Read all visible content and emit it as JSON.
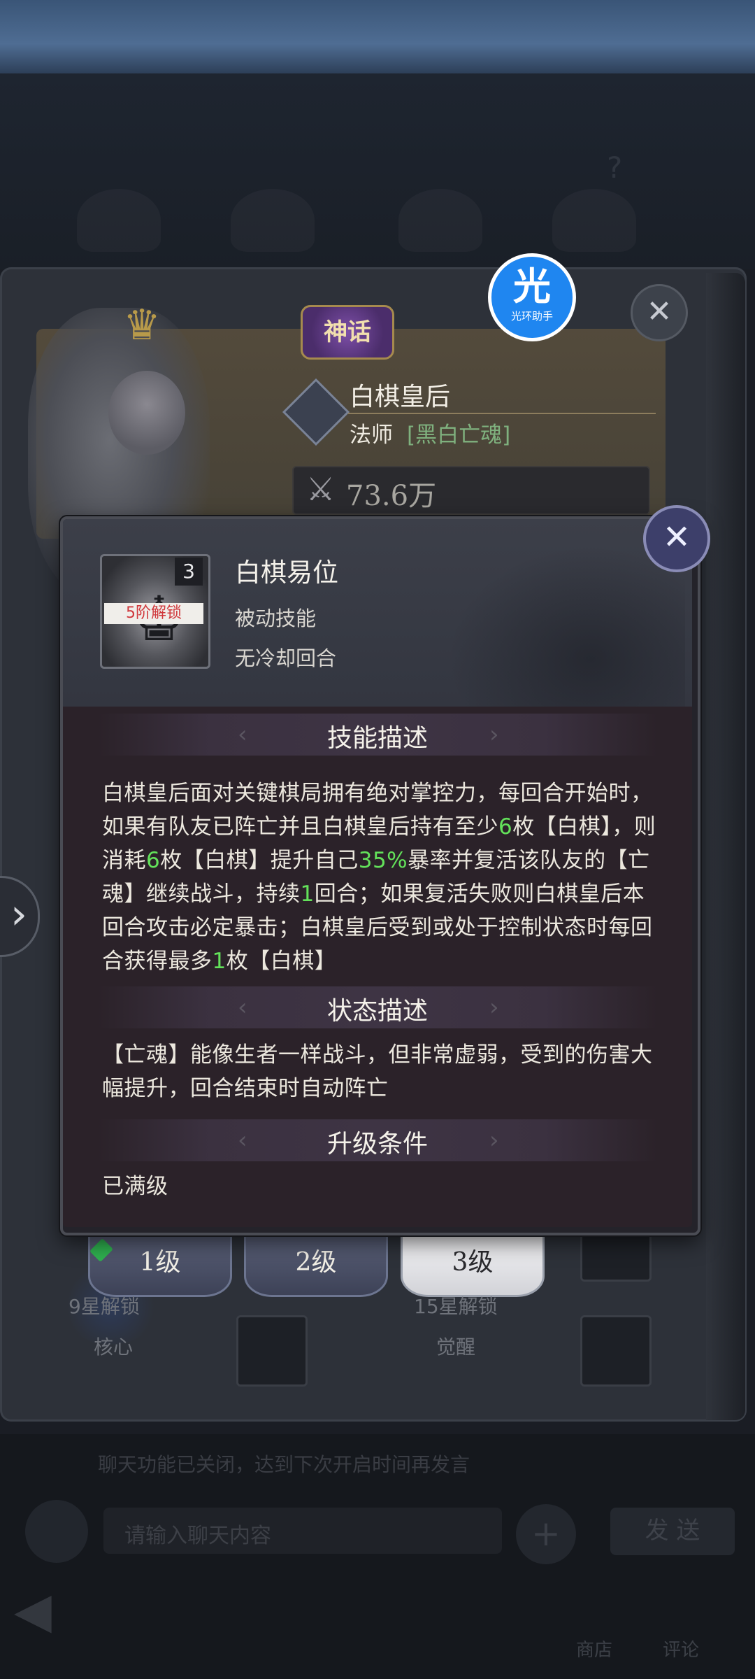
{
  "helper_badge": {
    "glyph": "光",
    "label": "光环助手"
  },
  "hero": {
    "rarity_badge": "神话",
    "name": "白棋皇后",
    "class": "法师",
    "faction": "[黑白亡魂]",
    "power": "73.6万"
  },
  "skill_popup": {
    "skill_name": "白棋易位",
    "skill_level": "3",
    "lock_text": "5阶解锁",
    "skill_type": "被动技能",
    "cooldown": "无冷却回合",
    "sections": {
      "skill_desc_title": "技能描述",
      "status_desc_title": "状态描述",
      "upgrade_title": "升级条件"
    },
    "skill_desc": {
      "p1": "白棋皇后面对关键棋局拥有绝对掌控力，每回合开始时，如果有队友已阵亡并且白棋皇后持有至少",
      "n1": "6",
      "p2": "枚【白棋】，则消耗",
      "n2": "6",
      "p3": "枚【白棋】提升自己",
      "n3": "35%",
      "p4": "暴率并复活该队友的【亡魂】继续战斗，持续",
      "n4": "1",
      "p5": "回合；如果复活失败则白棋皇后本回合攻击必定暴击；白棋皇后受到或处于控制状态时每回合获得最多",
      "n5": "1",
      "p6": "枚【白棋】"
    },
    "status_desc": "【亡魂】能像生者一样战斗，但非常虚弱，受到的伤害大幅提升，回合结束时自动阵亡",
    "upgrade_text": "已满级"
  },
  "level_tabs": [
    "1级",
    "2级",
    "3级"
  ],
  "slots": {
    "core_unlock": "9星解锁",
    "core_label": "核心",
    "awaken_unlock": "15星解锁",
    "awaken_label": "觉醒"
  },
  "chat": {
    "notice": "聊天功能已关闭，达到下次开启时间再发言",
    "input_placeholder": "请输入聊天内容",
    "send_label": "发 送"
  },
  "bottom_nav": {
    "btn1": "商店",
    "btn2": "评论"
  }
}
